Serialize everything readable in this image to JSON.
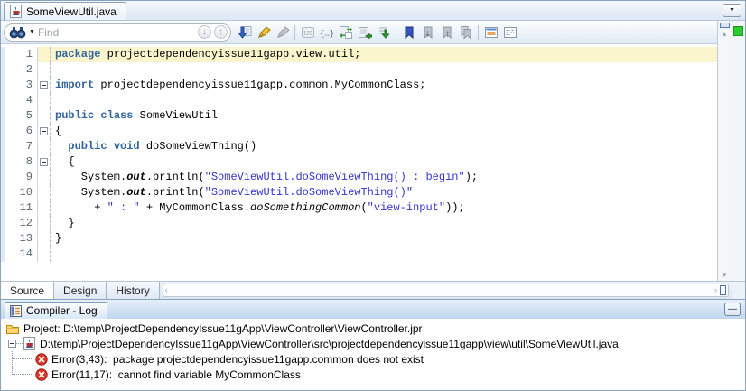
{
  "editor_tab": {
    "title": "SomeViewUtil.java"
  },
  "find_toolbar": {
    "placeholder": "Find",
    "items": [
      {
        "name": "search-arrow-icon"
      },
      {
        "name": "highlighter-icon"
      },
      {
        "name": "highlighter-disabled-icon"
      },
      {
        "name": "separator"
      },
      {
        "name": "number-list-icon"
      },
      {
        "name": "braces-icon"
      },
      {
        "name": "replace-icon"
      },
      {
        "name": "indent-icon"
      },
      {
        "name": "goto-last-edit-icon"
      },
      {
        "name": "separator"
      },
      {
        "name": "bookmark-icon"
      },
      {
        "name": "next-bookmark-icon"
      },
      {
        "name": "previous-bookmark-icon"
      },
      {
        "name": "clear-bookmarks-icon"
      },
      {
        "name": "separator"
      },
      {
        "name": "console-window-icon"
      },
      {
        "name": "preview-window-icon"
      }
    ]
  },
  "code": {
    "lines": [
      {
        "n": 1,
        "hl": true,
        "t": [
          [
            "kw",
            "package"
          ],
          [
            "txt",
            " projectdependencyissue11gapp.view.util;"
          ]
        ]
      },
      {
        "n": 2,
        "t": []
      },
      {
        "n": 3,
        "fold": true,
        "t": [
          [
            "kw",
            "import"
          ],
          [
            "txt",
            " projectdependencyissue11gapp.common.MyCommonClass;"
          ]
        ]
      },
      {
        "n": 4,
        "t": []
      },
      {
        "n": 5,
        "t": [
          [
            "kw",
            "public"
          ],
          [
            "txt",
            " "
          ],
          [
            "kw",
            "class"
          ],
          [
            "txt",
            " SomeViewUtil"
          ]
        ]
      },
      {
        "n": 6,
        "fold": true,
        "t": [
          [
            "txt",
            "{"
          ]
        ]
      },
      {
        "n": 7,
        "t": [
          [
            "txt",
            "  "
          ],
          [
            "kw",
            "public"
          ],
          [
            "txt",
            " "
          ],
          [
            "kw",
            "void"
          ],
          [
            "txt",
            " doSomeViewThing()"
          ]
        ]
      },
      {
        "n": 8,
        "fold": true,
        "t": [
          [
            "txt",
            "  {"
          ]
        ]
      },
      {
        "n": 9,
        "t": [
          [
            "txt",
            "    System."
          ],
          [
            "fld",
            "out"
          ],
          [
            "txt",
            ".println("
          ],
          [
            "str",
            "\"SomeViewUtil.doSomeViewThing() : begin\""
          ],
          [
            "txt",
            ");"
          ]
        ]
      },
      {
        "n": 10,
        "t": [
          [
            "txt",
            "    System."
          ],
          [
            "fld",
            "out"
          ],
          [
            "txt",
            ".println("
          ],
          [
            "str",
            "\"SomeViewUtil.doSomeViewThing()\""
          ]
        ]
      },
      {
        "n": 11,
        "t": [
          [
            "txt",
            "      + "
          ],
          [
            "str",
            "\" : \""
          ],
          [
            "txt",
            " + MyCommonClass."
          ],
          [
            "stm",
            "doSomethingCommon"
          ],
          [
            "txt",
            "("
          ],
          [
            "str",
            "\"view-input\""
          ],
          [
            "txt",
            "));"
          ]
        ]
      },
      {
        "n": 12,
        "t": [
          [
            "txt",
            "  }"
          ]
        ]
      },
      {
        "n": 13,
        "t": [
          [
            "txt",
            "}"
          ]
        ]
      },
      {
        "n": 14,
        "t": []
      }
    ]
  },
  "editor_tabs": [
    {
      "label": "Source",
      "active": true
    },
    {
      "label": "Design",
      "active": false
    },
    {
      "label": "History",
      "active": false
    }
  ],
  "log_panel": {
    "tab_label": "Compiler - Log",
    "rows": [
      {
        "level": 0,
        "icon": "folder-icon",
        "text": "Project: D:\\temp\\ProjectDependencyIssue11gApp\\ViewController\\ViewController.jpr"
      },
      {
        "level": 1,
        "icon": "java-file-icon",
        "expanded": true,
        "text": "D:\\temp\\ProjectDependencyIssue11gApp\\ViewController\\src\\projectdependencyissue11gapp\\view\\util\\SomeViewUtil.java"
      },
      {
        "level": 2,
        "icon": "error-icon",
        "text": "Error(3,43):  package projectdependencyissue11gapp.common does not exist"
      },
      {
        "level": 2,
        "icon": "error-icon",
        "text": "Error(11,17):  cannot find variable MyCommonClass",
        "last": true
      }
    ]
  },
  "colors": {
    "keyword": "#31639C",
    "string": "#3333CC",
    "line_highlight": "#FBF5CD",
    "status_ok": "#2ECC2E"
  },
  "glyphs": {
    "tab_dropdown": "▼",
    "scroll_up": "▲",
    "scroll_down": "▼",
    "find_down": "↓",
    "find_up": "↑",
    "chev_left": "‹",
    "chev_right": "›",
    "minimize": "—"
  }
}
